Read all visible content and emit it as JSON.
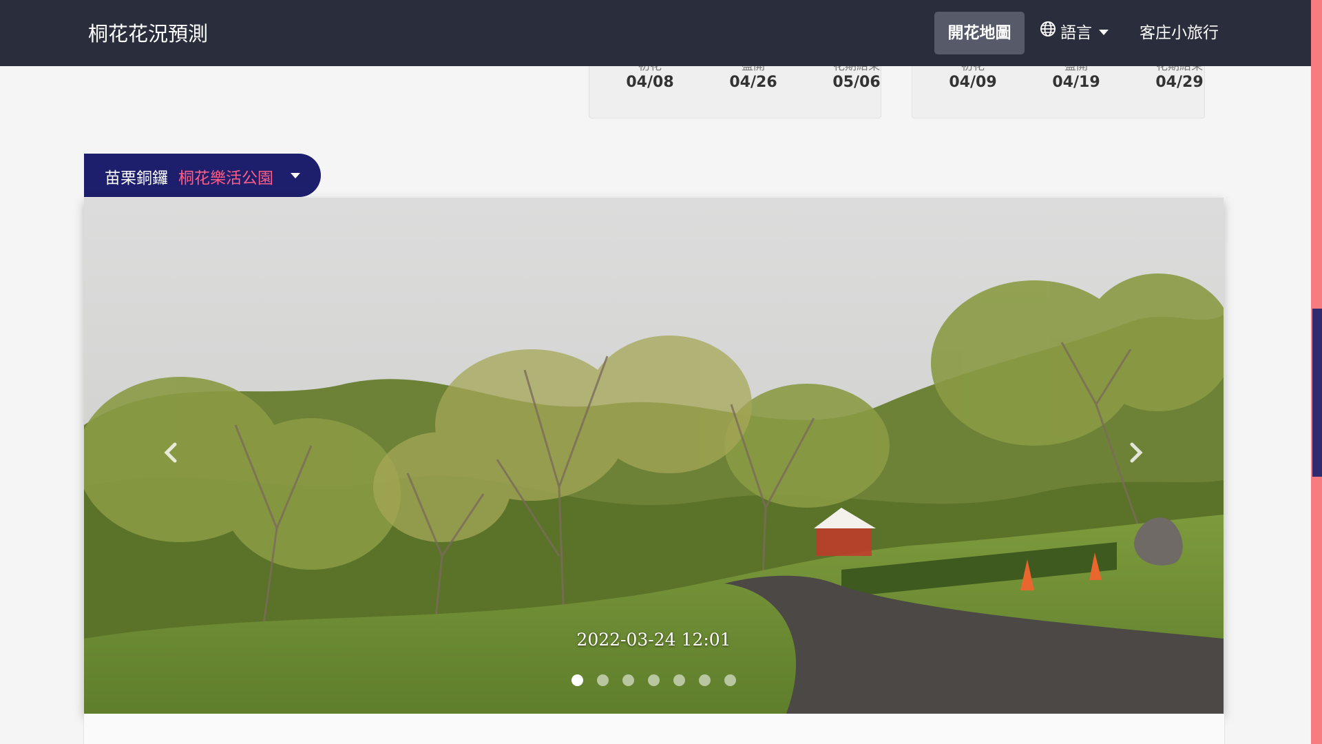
{
  "navbar": {
    "brand": "桐花花況預測",
    "map_label": "開花地圖",
    "lang_label": "語言",
    "trip_label": "客庄小旅行"
  },
  "cards": [
    {
      "cols": [
        {
          "label": "初花",
          "date": "04/08"
        },
        {
          "label": "盛開",
          "date": "04/26"
        },
        {
          "label": "花期結束",
          "date": "05/06"
        }
      ]
    },
    {
      "cols": [
        {
          "label": "初花",
          "date": "04/09"
        },
        {
          "label": "盛開",
          "date": "04/19"
        },
        {
          "label": "花期結束",
          "date": "04/29"
        }
      ]
    }
  ],
  "location": {
    "region": "苗栗銅鑼",
    "site": "桐花樂活公園"
  },
  "carousel": {
    "timestamp": "2022-03-24 12:01",
    "slide_count": 7,
    "active_index": 0
  },
  "icons": {
    "globe": "globe-icon",
    "caret": "caret-down-icon",
    "prev": "chevron-left-icon",
    "next": "chevron-right-icon"
  },
  "colors": {
    "navbar": "#2a2d3b",
    "location_bg": "#1d1f6c",
    "location_site": "#ff5c86",
    "scrollbar_track": "#f77b7f",
    "scrollbar_thumb": "#2f2b6e"
  }
}
